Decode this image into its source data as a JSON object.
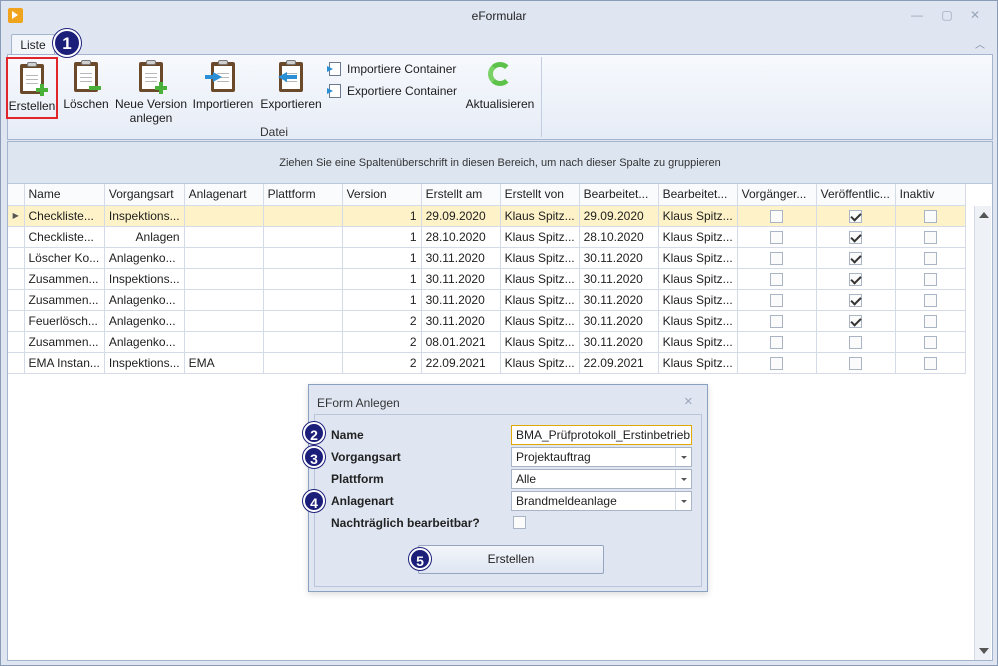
{
  "window": {
    "title": "eFormular"
  },
  "tabs": {
    "liste": "Liste"
  },
  "ribbon": {
    "group_label": "Datei",
    "buttons": {
      "erstellen": "Erstellen",
      "loeschen": "Löschen",
      "neue_version_1": "Neue Version",
      "neue_version_2": "anlegen",
      "importieren": "Importieren",
      "exportieren": "Exportieren",
      "importiere_container": "Importiere Container",
      "exportiere_container": "Exportiere Container",
      "aktualisieren": "Aktualisieren"
    }
  },
  "grid": {
    "group_hint": "Ziehen Sie eine Spaltenüberschrift in diesen Bereich, um nach dieser Spalte zu gruppieren",
    "columns": [
      "Name",
      "Vorgangsart",
      "Anlagenart",
      "Plattform",
      "Version",
      "Erstellt am",
      "Erstellt von",
      "Bearbeitet...",
      "Bearbeitet...",
      "Vorgänger...",
      "Veröffentlic...",
      "Inaktiv"
    ],
    "rows": [
      {
        "name": "Checkliste...",
        "vorgangsart": "Inspektions...",
        "anlagenart": "",
        "plattform": "",
        "version": "1",
        "erstellt_am": "29.09.2020",
        "erstellt_von": "Klaus Spitz...",
        "bearbeitet_am": "29.09.2020",
        "bearbeitet_von": "Klaus Spitz...",
        "vorgaenger": false,
        "veroeffentlicht": true,
        "inaktiv": false
      },
      {
        "name": "Checkliste...",
        "vorgangsart": "Anlagen",
        "anlagenart": "",
        "plattform": "",
        "version": "1",
        "erstellt_am": "28.10.2020",
        "erstellt_von": "Klaus Spitz...",
        "bearbeitet_am": "28.10.2020",
        "bearbeitet_von": "Klaus Spitz...",
        "vorgaenger": false,
        "veroeffentlicht": true,
        "inaktiv": false
      },
      {
        "name": "Löscher Ko...",
        "vorgangsart": "Anlagenko...",
        "anlagenart": "",
        "plattform": "",
        "version": "1",
        "erstellt_am": "30.11.2020",
        "erstellt_von": "Klaus Spitz...",
        "bearbeitet_am": "30.11.2020",
        "bearbeitet_von": "Klaus Spitz...",
        "vorgaenger": false,
        "veroeffentlicht": true,
        "inaktiv": false
      },
      {
        "name": "Zusammen...",
        "vorgangsart": "Inspektions...",
        "anlagenart": "",
        "plattform": "",
        "version": "1",
        "erstellt_am": "30.11.2020",
        "erstellt_von": "Klaus Spitz...",
        "bearbeitet_am": "30.11.2020",
        "bearbeitet_von": "Klaus Spitz...",
        "vorgaenger": false,
        "veroeffentlicht": true,
        "inaktiv": false
      },
      {
        "name": "Zusammen...",
        "vorgangsart": "Anlagenko...",
        "anlagenart": "",
        "plattform": "",
        "version": "1",
        "erstellt_am": "30.11.2020",
        "erstellt_von": "Klaus Spitz...",
        "bearbeitet_am": "30.11.2020",
        "bearbeitet_von": "Klaus Spitz...",
        "vorgaenger": false,
        "veroeffentlicht": true,
        "inaktiv": false
      },
      {
        "name": "Feuerlösch...",
        "vorgangsart": "Anlagenko...",
        "anlagenart": "",
        "plattform": "",
        "version": "2",
        "erstellt_am": "30.11.2020",
        "erstellt_von": "Klaus Spitz...",
        "bearbeitet_am": "30.11.2020",
        "bearbeitet_von": "Klaus Spitz...",
        "vorgaenger": false,
        "veroeffentlicht": true,
        "inaktiv": false
      },
      {
        "name": "Zusammen...",
        "vorgangsart": "Anlagenko...",
        "anlagenart": "",
        "plattform": "",
        "version": "2",
        "erstellt_am": "08.01.2021",
        "erstellt_von": "Klaus Spitz...",
        "bearbeitet_am": "30.11.2020",
        "bearbeitet_von": "Klaus Spitz...",
        "vorgaenger": false,
        "veroeffentlicht": false,
        "inaktiv": false
      },
      {
        "name": "EMA Instan...",
        "vorgangsart": "Inspektions...",
        "anlagenart": "EMA",
        "plattform": "",
        "version": "2",
        "erstellt_am": "22.09.2021",
        "erstellt_von": "Klaus Spitz...",
        "bearbeitet_am": "22.09.2021",
        "bearbeitet_von": "Klaus Spitz...",
        "vorgaenger": false,
        "veroeffentlicht": false,
        "inaktiv": false
      }
    ]
  },
  "dialog": {
    "title": "EForm Anlegen",
    "labels": {
      "name": "Name",
      "vorgangsart": "Vorgangsart",
      "plattform": "Plattform",
      "anlagenart": "Anlagenart",
      "nachtraeglich": "Nachträglich bearbeitbar?"
    },
    "values": {
      "name": "BMA_Prüfprotokoll_Erstinbetrieb",
      "vorgangsart": "Projektauftrag",
      "plattform": "Alle",
      "anlagenart": "Brandmeldeanlage",
      "nachtraeglich": false
    },
    "submit": "Erstellen"
  },
  "markers": [
    "1",
    "2",
    "3",
    "4",
    "5"
  ],
  "colors": {
    "selection_highlight": "#e0252b",
    "marker": "#1b1f7a",
    "selected_row": "#fdf2c8"
  }
}
